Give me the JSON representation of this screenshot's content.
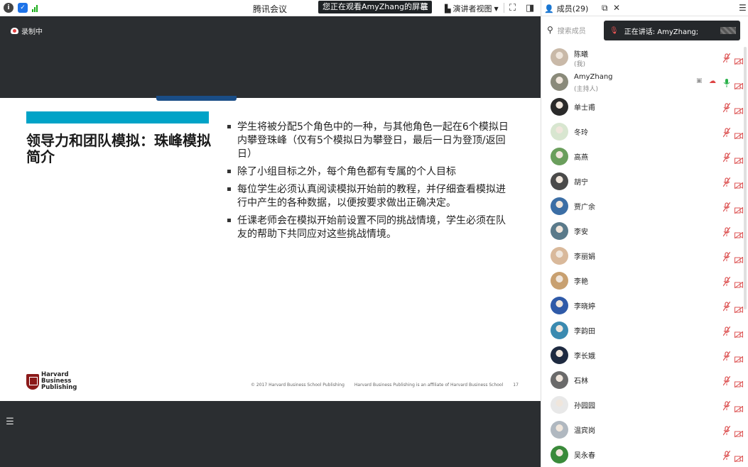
{
  "topbar": {
    "app_title": "腾讯会议",
    "share_banner": "您正在观看AmyZhang的屏幕",
    "presenter_view": "演讲者视图",
    "icons": [
      "info-icon",
      "shield-icon",
      "signal-icon",
      "menu-icon",
      "fullscreen-icon",
      "layout-icon"
    ]
  },
  "recording": {
    "label": "录制中",
    "icon": "cloud-record-icon"
  },
  "slide": {
    "title": "领导力和团队模拟：珠峰模拟简介",
    "accent_color": "#00a3c7",
    "bullets": [
      "学生将被分配5个角色中的一种，与其他角色一起在6个模拟日内攀登珠峰（仅有5个模拟日为攀登日，最后一日为登顶/返回日）",
      "除了小组目标之外，每个角色都有专属的个人目标",
      "每位学生必须认真阅读模拟开始前的教程，并仔细查看模拟进行中产生的各种数据，以便按要求做出正确决定。",
      "任课老师会在模拟开始前设置不同的挑战情境，学生必须在队友的帮助下共同应对这些挑战情境。"
    ],
    "logo_lines": [
      "Harvard",
      "Business",
      "Publishing"
    ],
    "footer_copyright": "© 2017 Harvard Business School Publishing",
    "footer_affiliate": "Harvard Business Publishing is an affiliate of Harvard Business School",
    "page_number": "17"
  },
  "panel": {
    "members_tab": "成员(29)",
    "search_placeholder": "搜索成员",
    "speaking_label": "正在讲话:",
    "speaking_name": "AmyZhang;",
    "members": [
      {
        "name": "陈曦",
        "sub": "(我)",
        "avatar": "#c9b9a8",
        "mic": "muted"
      },
      {
        "name": "AmyZhang",
        "sub": "(主持人)",
        "avatar": "#8a8a7a",
        "mic": "active"
      },
      {
        "name": "单士甫",
        "sub": "",
        "avatar": "#2a2a2a",
        "mic": "muted"
      },
      {
        "name": "冬玲",
        "sub": "",
        "avatar": "#d8e6d0",
        "mic": "muted"
      },
      {
        "name": "高燕",
        "sub": "",
        "avatar": "#6a9e5c",
        "mic": "muted"
      },
      {
        "name": "胡宁",
        "sub": "",
        "avatar": "#4a4a4a",
        "mic": "muted"
      },
      {
        "name": "贾广余",
        "sub": "",
        "avatar": "#3b6ea5",
        "mic": "muted"
      },
      {
        "name": "李安",
        "sub": "",
        "avatar": "#5a7a8a",
        "mic": "muted"
      },
      {
        "name": "李丽娟",
        "sub": "",
        "avatar": "#d9b99b",
        "mic": "muted"
      },
      {
        "name": "李艳",
        "sub": "",
        "avatar": "#c8a070",
        "mic": "muted"
      },
      {
        "name": "李晓婷",
        "sub": "",
        "avatar": "#2f5aa8",
        "mic": "muted"
      },
      {
        "name": "李韵田",
        "sub": "",
        "avatar": "#3a8ab0",
        "mic": "muted"
      },
      {
        "name": "李长娥",
        "sub": "",
        "avatar": "#1e2a40",
        "mic": "muted"
      },
      {
        "name": "石林",
        "sub": "",
        "avatar": "#6a6a6a",
        "mic": "muted"
      },
      {
        "name": "孙园园",
        "sub": "",
        "avatar": "#e8e8e8",
        "mic": "muted"
      },
      {
        "name": "温宾岗",
        "sub": "",
        "avatar": "#b0b8c0",
        "mic": "muted"
      },
      {
        "name": "吴永春",
        "sub": "",
        "avatar": "#3a8a3a",
        "mic": "muted"
      }
    ]
  }
}
